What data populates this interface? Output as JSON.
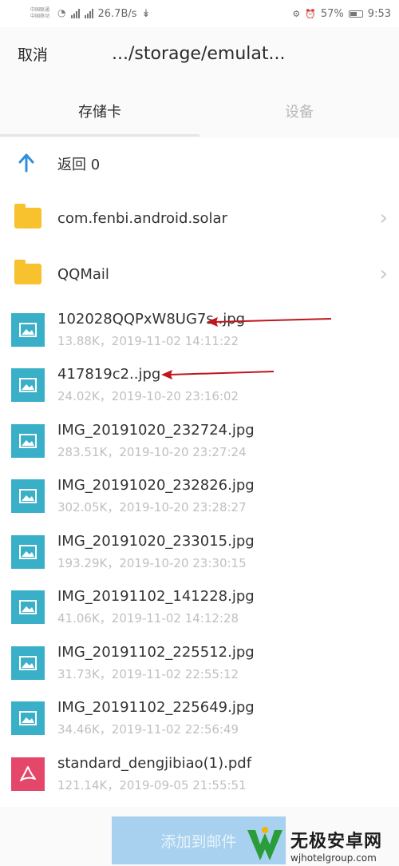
{
  "status_bar": {
    "carrier_line1": "中国联通",
    "carrier_line2": "中国移动",
    "network_speed": "26.7B/s",
    "battery": "57%",
    "battery_level": 0.57,
    "time": "9:53"
  },
  "header": {
    "cancel_label": "取消",
    "path": ".../storage/emulat..."
  },
  "tabs": [
    {
      "label": "存储卡",
      "active": true
    },
    {
      "label": "设备",
      "active": false
    }
  ],
  "back_row": {
    "label": "返回 0"
  },
  "folders": [
    {
      "name": "com.fenbi.android.solar"
    },
    {
      "name": "QQMail"
    }
  ],
  "files": [
    {
      "name": "102028QQPxW8UG7s..jpg",
      "meta": "13.88K，2019-11-02 14:11:22",
      "type": "image"
    },
    {
      "name": "417819c2..jpg",
      "meta": "24.02K，2019-10-20 23:16:02",
      "type": "image"
    },
    {
      "name": "IMG_20191020_232724.jpg",
      "meta": "283.51K，2019-10-20 23:27:24",
      "type": "image"
    },
    {
      "name": "IMG_20191020_232826.jpg",
      "meta": "302.05K，2019-10-20 23:28:27",
      "type": "image"
    },
    {
      "name": "IMG_20191020_233015.jpg",
      "meta": "193.29K，2019-10-20 23:30:15",
      "type": "image"
    },
    {
      "name": "IMG_20191102_141228.jpg",
      "meta": "41.06K，2019-11-02 14:12:28",
      "type": "image"
    },
    {
      "name": "IMG_20191102_225512.jpg",
      "meta": "31.73K，2019-11-02 22:55:12",
      "type": "image"
    },
    {
      "name": "IMG_20191102_225649.jpg",
      "meta": "34.46K，2019-11-02 22:56:49",
      "type": "image"
    },
    {
      "name": "standard_dengjibiao(1).pdf",
      "meta": "121.14K，2019-09-05 21:55:51",
      "type": "pdf"
    }
  ],
  "bottom": {
    "add_label": "添加到邮件"
  },
  "watermark": {
    "name": "无极安卓网",
    "url": "wjhotelgroup.com"
  },
  "colors": {
    "folder": "#f7c22e",
    "image_icon": "#39b0c8",
    "pdf_icon": "#e5476b",
    "back_arrow": "#2f8fdc",
    "annotation_arrow": "#c0161c",
    "add_button": "#a7d1ee"
  },
  "icons": {
    "back": "back-arrow-icon",
    "folder": "folder-icon",
    "image": "image-file-icon",
    "pdf": "pdf-file-icon",
    "chevron": "chevron-right-icon"
  }
}
